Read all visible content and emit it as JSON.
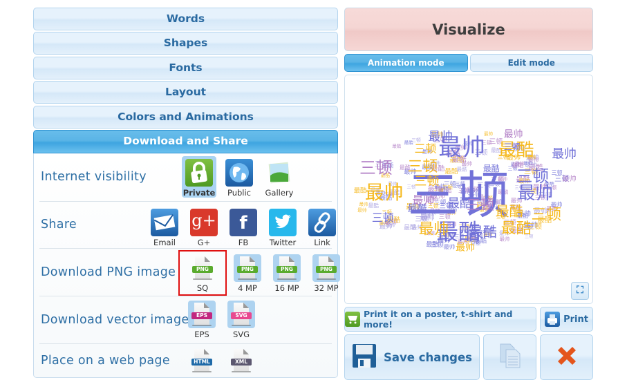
{
  "accordion": {
    "items": [
      {
        "label": "Words",
        "active": false
      },
      {
        "label": "Shapes",
        "active": false
      },
      {
        "label": "Fonts",
        "active": false
      },
      {
        "label": "Layout",
        "active": false
      },
      {
        "label": "Colors and Animations",
        "active": false
      },
      {
        "label": "Download and Share",
        "active": true
      }
    ]
  },
  "download_share": {
    "visibility": {
      "label": "Internet visibility",
      "options": [
        {
          "label": "Private",
          "icon": "lock-icon",
          "selected": true
        },
        {
          "label": "Public",
          "icon": "globe-icon",
          "selected": false
        },
        {
          "label": "Gallery",
          "icon": "gallery-icon",
          "selected": false
        }
      ]
    },
    "share": {
      "label": "Share",
      "options": [
        {
          "label": "Email",
          "icon": "email-icon",
          "color": "#2e7cc0"
        },
        {
          "label": "G+",
          "icon": "google-plus-icon",
          "color": "#d9392b"
        },
        {
          "label": "FB",
          "icon": "facebook-icon",
          "color": "#3b5998"
        },
        {
          "label": "Twitter",
          "icon": "twitter-icon",
          "color": "#27b8ec"
        },
        {
          "label": "Link",
          "icon": "link-icon",
          "color": "#2e7cc0"
        }
      ]
    },
    "png": {
      "label": "Download PNG image",
      "options": [
        {
          "label": "SQ",
          "badge": "PNG",
          "highlighted": true
        },
        {
          "label": "4 MP",
          "badge": "PNG",
          "highlighted": false
        },
        {
          "label": "16 MP",
          "badge": "PNG",
          "highlighted": false
        },
        {
          "label": "32 MP",
          "badge": "PNG",
          "highlighted": false
        }
      ],
      "badge_color": "#5aab2e"
    },
    "vector": {
      "label": "Download vector image",
      "options": [
        {
          "label": "EPS",
          "badge": "EPS",
          "color": "#c2277f"
        },
        {
          "label": "SVG",
          "badge": "SVG",
          "color": "#e8488f"
        }
      ]
    },
    "web": {
      "label": "Place on a web page",
      "options": [
        {
          "badge": "HTML",
          "color": "#1f6aa8"
        },
        {
          "badge": "XML",
          "color": "#5c5870"
        }
      ]
    }
  },
  "right": {
    "visualize_label": "Visualize",
    "modes": [
      {
        "label": "Animation mode",
        "active": true
      },
      {
        "label": "Edit mode",
        "active": false
      }
    ],
    "fullscreen_icon": "⛶",
    "print_poster_label": "Print it on a poster, t-shirt and more!",
    "print_label": "Print",
    "save_label": "Save changes"
  },
  "word_cloud": {
    "words": [
      "三顿",
      "最帅",
      "最酷"
    ],
    "colors": [
      "#7272d8",
      "#f5b81c",
      "#b27fc6",
      "#a8a0e0"
    ]
  }
}
